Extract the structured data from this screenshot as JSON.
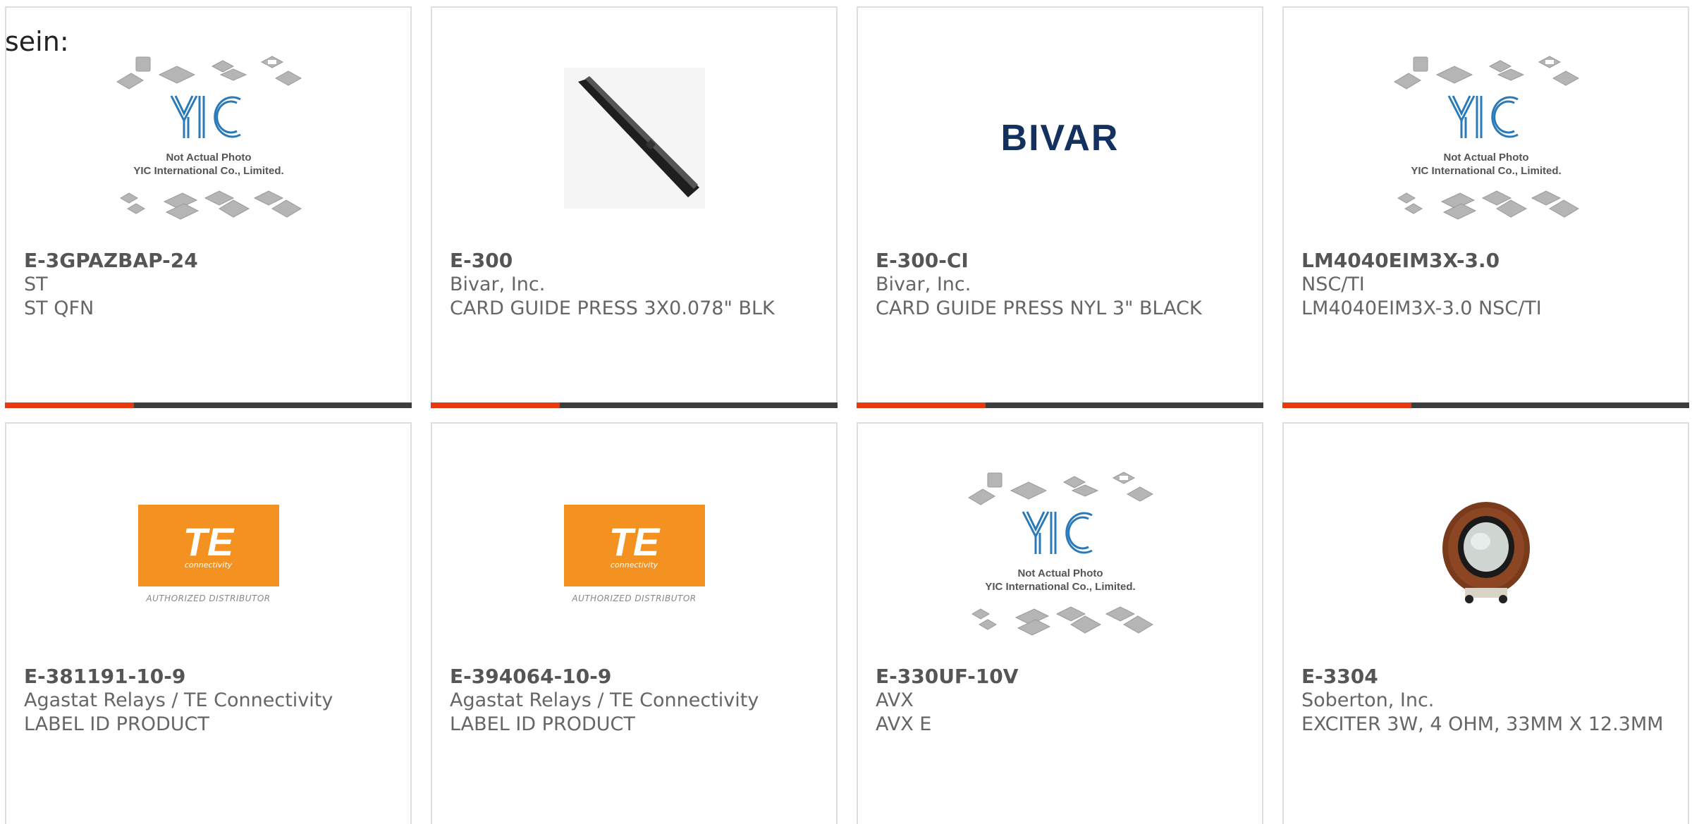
{
  "intro": "sein:",
  "colors": {
    "accent": "#e8380d",
    "bar": "#3d3d3d",
    "border": "#dedede",
    "bivar_blue": "#13305e",
    "te_orange": "#f39220"
  },
  "placeholder": {
    "line1": "Not Actual Photo",
    "line2": "YIC International Co., Limited."
  },
  "products": [
    {
      "part": "E-3GPAZBAP-24",
      "mfr": "ST",
      "desc": "ST QFN",
      "image": "yic-placeholder"
    },
    {
      "part": "E-300",
      "mfr": "Bivar, Inc.",
      "desc": "CARD GUIDE PRESS 3X0.078\" BLK",
      "image": "card-guide-photo"
    },
    {
      "part": "E-300-CI",
      "mfr": "Bivar, Inc.",
      "desc": "CARD GUIDE PRESS NYL 3\" BLACK",
      "image": "bivar-logo",
      "logo_text": "BIVAR"
    },
    {
      "part": "LM4040EIM3X-3.0",
      "mfr": "NSC/TI",
      "desc": "LM4040EIM3X-3.0 NSC/TI",
      "image": "yic-placeholder"
    },
    {
      "part": "E-381191-10-9",
      "mfr": "Agastat Relays / TE Connectivity",
      "desc": "LABEL ID PRODUCT",
      "image": "te-logo",
      "logo_text": "TE",
      "logo_sub": "connectivity",
      "logo_caption": "AUTHORIZED DISTRIBUTOR"
    },
    {
      "part": "E-394064-10-9",
      "mfr": "Agastat Relays / TE Connectivity",
      "desc": "LABEL ID PRODUCT",
      "image": "te-logo",
      "logo_text": "TE",
      "logo_sub": "connectivity",
      "logo_caption": "AUTHORIZED DISTRIBUTOR"
    },
    {
      "part": "E-330UF-10V",
      "mfr": "AVX",
      "desc": "AVX E",
      "image": "yic-placeholder"
    },
    {
      "part": "E-3304",
      "mfr": "Soberton, Inc.",
      "desc": "EXCITER 3W, 4 OHM, 33MM X 12.3MM",
      "image": "exciter-photo"
    }
  ]
}
